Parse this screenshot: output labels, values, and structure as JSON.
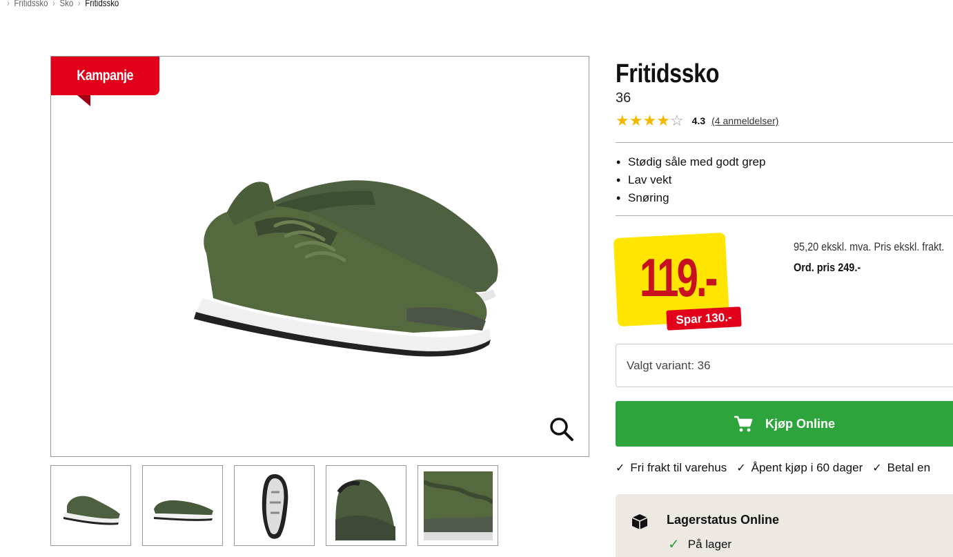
{
  "breadcrumb": {
    "items": [
      "Fritidssko",
      "Sko"
    ],
    "current": "Fritidssko"
  },
  "image": {
    "badge": "Kampanje",
    "badge_color": "#e2001a",
    "zoom_icon": "search-icon",
    "thumbnails": [
      "shoe-pair-view",
      "shoe-side-view",
      "shoe-sole-view",
      "shoe-heel-detail",
      "shoe-mesh-detail"
    ]
  },
  "product": {
    "title": "Fritidssko",
    "variant_size": "36",
    "rating": {
      "value": "4.3",
      "reviews_label": "(4 anmeldelser)",
      "stars": 4.3,
      "max": 5
    },
    "features": [
      "Stødig såle med godt grep",
      "Lav vekt",
      "Snøring"
    ]
  },
  "price": {
    "current": "119.-",
    "save": "Spar 130.-",
    "excl_text": "95,20 ekskl. mva. Pris ekskl. frakt.",
    "ordinary": "Ord. pris 249.-",
    "price_bg": "#ffe500",
    "price_color": "#c8101e"
  },
  "variant": {
    "label": "Valgt variant: 36"
  },
  "buy": {
    "label": "Kjøp Online",
    "icon": "cart-icon",
    "color": "#2ea53c"
  },
  "usps": [
    "Fri frakt til varehus",
    "Åpent kjøp i 60 dager",
    "Betal en"
  ],
  "stock": {
    "title": "Lagerstatus Online",
    "status": "På lager",
    "icon": "box-icon"
  }
}
